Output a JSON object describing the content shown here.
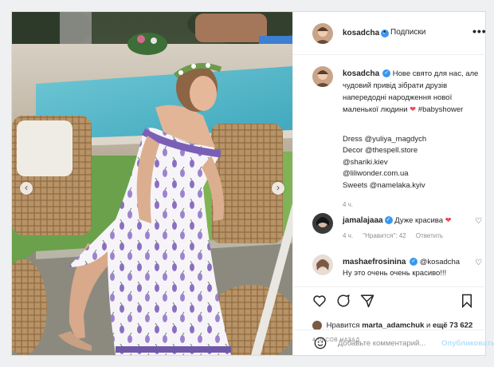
{
  "post": {
    "author": {
      "username": "kosadcha",
      "verified_icon": "verified-badge-icon",
      "follow_label": "Подписки",
      "more_label": "•••"
    },
    "caption": {
      "text": "Нове свято для нас, але чудовий привід зібрати друзів напередодні народження нової маленької людини",
      "heart": "❤",
      "hashtag": "#babyshower",
      "credits": [
        "Dress @yuliya_magdych",
        "Decor @thespell.store",
        "@shariki.kiev",
        "@liliwonder.com.ua",
        "Sweets @namelaka.kyiv"
      ],
      "time": "4 ч."
    },
    "comments": [
      {
        "username": "jamalajaaa",
        "text": "Дуже красива",
        "heart": "❤",
        "time": "4 ч.",
        "likes": "\"Нравится\": 42",
        "reply_label": "Ответить"
      },
      {
        "username": "mashaefrosinina",
        "mention": "@kosadcha",
        "text": "Ну это очень очень красиво!!!"
      }
    ],
    "likes": {
      "prefix": "Нравится",
      "user": "marta_adamchuk",
      "connector": "и",
      "rest": "ещё 73 622"
    },
    "posted_ago": "4 ЧАСОВ НАЗАД",
    "add_comment": {
      "placeholder": "Добавьте комментарий...",
      "publish_label": "Опубликовать"
    },
    "nav": {
      "prev": "‹",
      "next": "›"
    },
    "icons": {
      "like": "heart-icon",
      "comment": "comment-icon",
      "share": "share-icon",
      "save": "bookmark-icon",
      "emoji": "smiley-icon"
    },
    "colors": {
      "verified": "#3897f0",
      "heart": "#ed4956",
      "publish_disabled": "#b2dffc",
      "muted": "#8e8e8e"
    }
  }
}
